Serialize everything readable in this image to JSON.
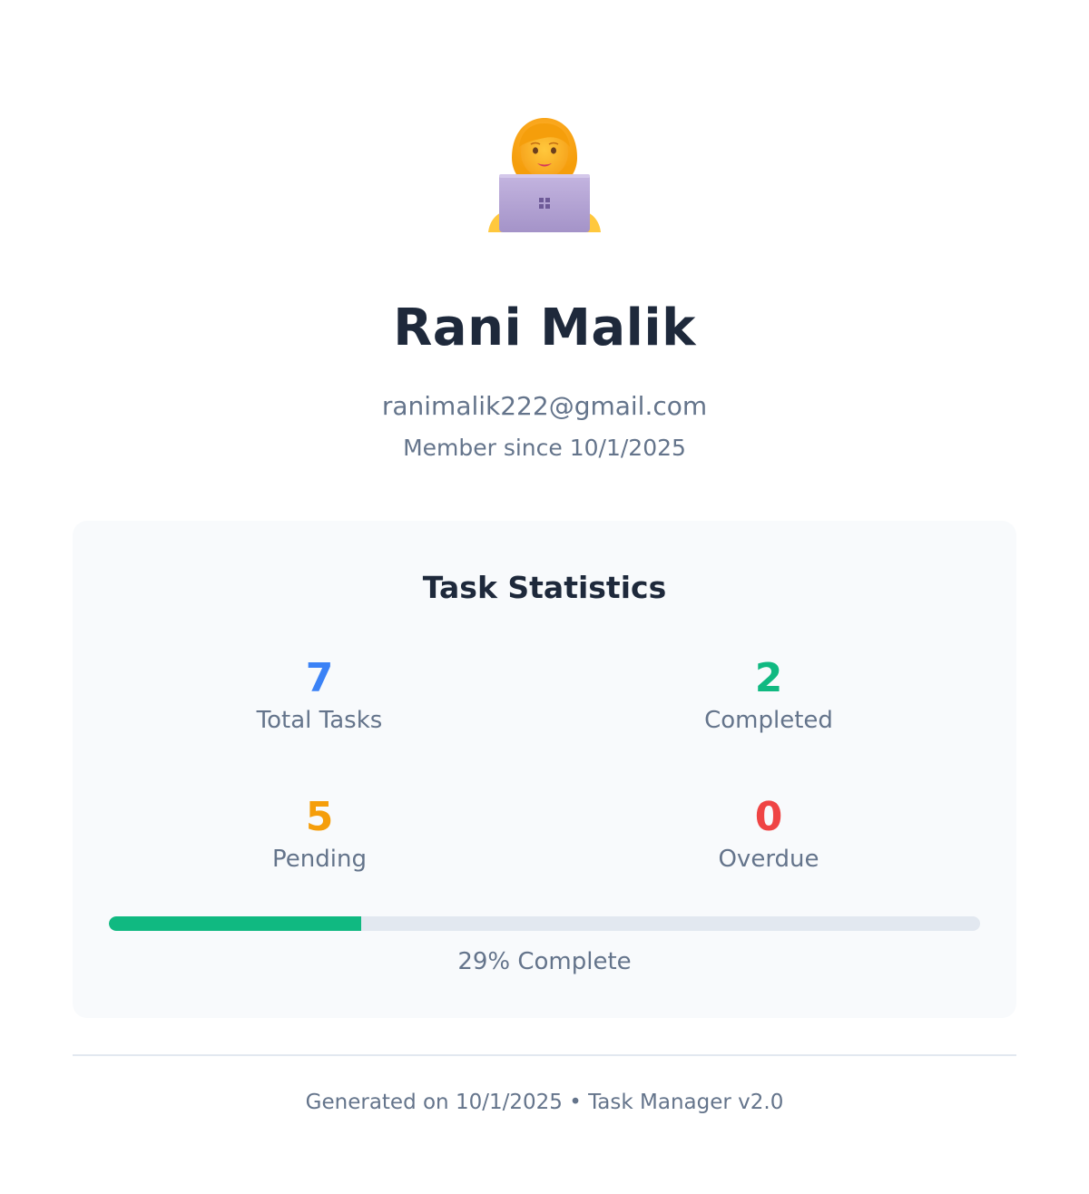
{
  "profile": {
    "avatar_icon": "woman-technologist-icon",
    "name": "Rani Malik",
    "email": "ranimalik222@gmail.com",
    "member_since": "Member since 10/1/2025"
  },
  "stats": {
    "title": "Task Statistics",
    "items": [
      {
        "value": "7",
        "label": "Total Tasks",
        "color": "#3b82f6"
      },
      {
        "value": "2",
        "label": "Completed",
        "color": "#10b981"
      },
      {
        "value": "5",
        "label": "Pending",
        "color": "#f59e0b"
      },
      {
        "value": "0",
        "label": "Overdue",
        "color": "#ef4444"
      }
    ],
    "progress_percent": 29,
    "progress_label": "29% Complete",
    "progress_color": "#10b981"
  },
  "footer": {
    "text": "Generated on 10/1/2025 • Task Manager v2.0"
  }
}
